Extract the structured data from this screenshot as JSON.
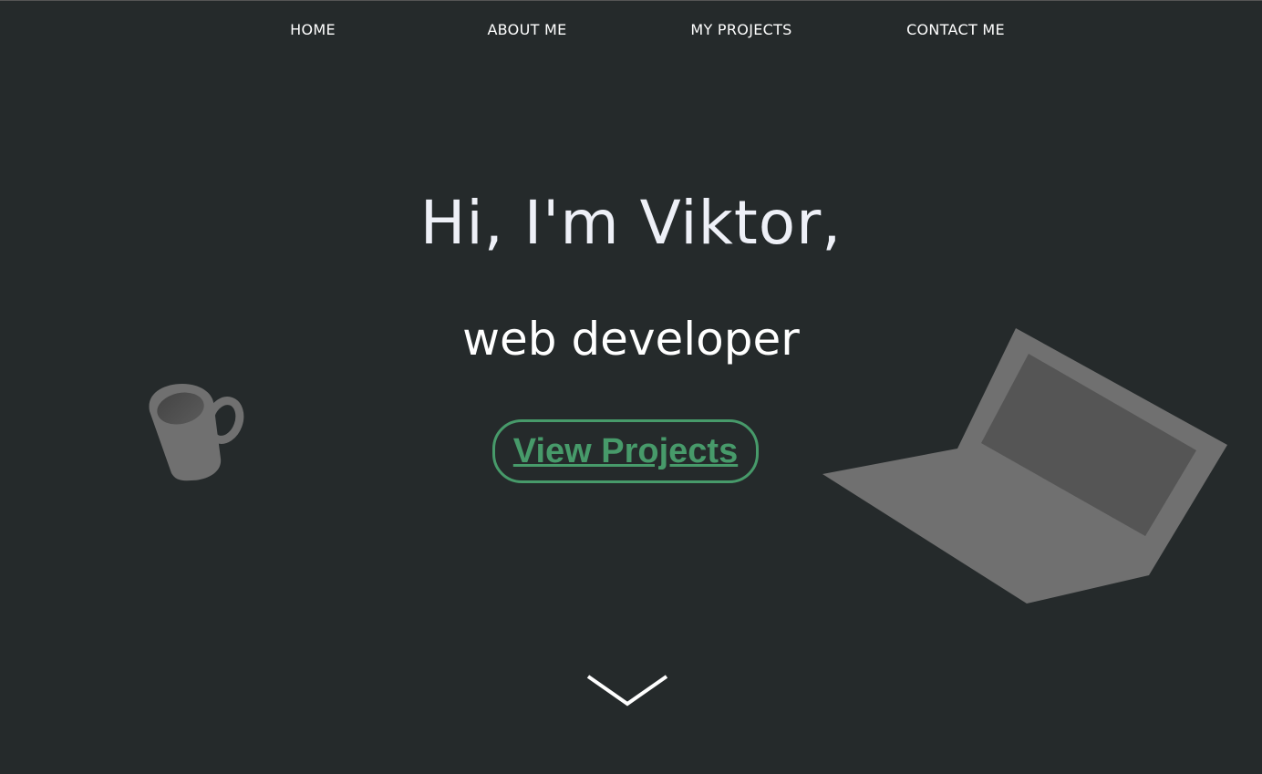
{
  "nav": {
    "items": [
      {
        "label": "HOME"
      },
      {
        "label": "ABOUT ME"
      },
      {
        "label": "MY PROJECTS"
      },
      {
        "label": "CONTACT ME"
      }
    ]
  },
  "hero": {
    "title": "Hi, I'm Viktor,",
    "subtitle": "web developer",
    "cta_label": "View Projects"
  },
  "icons": {
    "mug": "coffee-mug-icon",
    "laptop": "laptop-icon",
    "scroll": "chevron-down-icon"
  },
  "colors": {
    "background": "#252a2b",
    "accent": "#479a6a",
    "text": "#ffffff",
    "illustration": "#707070"
  }
}
